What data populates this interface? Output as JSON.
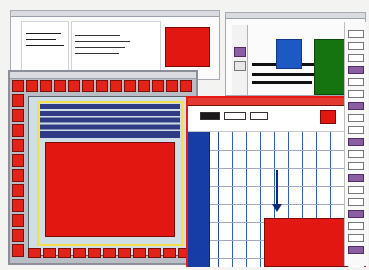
{
  "screen": {
    "windows": [
      {
        "id": "top-left",
        "title": ""
      },
      {
        "id": "main",
        "title": ""
      },
      {
        "id": "diagram",
        "title": ""
      },
      {
        "id": "bottom-right",
        "title": ""
      }
    ],
    "colors": {
      "accent_red": "#e31712",
      "blue": "#1d59c4",
      "green": "#15740f",
      "purple": "#8a5fa4",
      "yellow": "#f3de4b"
    }
  }
}
